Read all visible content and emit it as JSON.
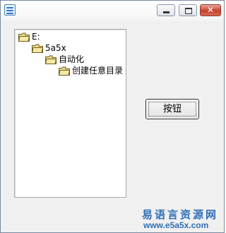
{
  "window": {
    "title": "",
    "icon": "app-icon",
    "controls": [
      "minimize-icon",
      "maximize-icon",
      "close-icon"
    ],
    "close_glyph": "✕"
  },
  "tree": {
    "nodes": [
      {
        "label": "E:",
        "level": 0,
        "icon": "folder-icon"
      },
      {
        "label": "5a5x",
        "level": 1,
        "icon": "folder-icon"
      },
      {
        "label": "自动化",
        "level": 2,
        "icon": "folder-icon"
      },
      {
        "label": "创建任意目录",
        "level": 3,
        "icon": "folder-icon"
      }
    ]
  },
  "button": {
    "label": "按钮"
  },
  "watermark": {
    "title": "易语言资源网",
    "url": "www.e5a5x.com"
  },
  "colors": {
    "watermark": "#2f6fb6",
    "close_button": "#c7412c",
    "folder": "#f1dc8a"
  }
}
